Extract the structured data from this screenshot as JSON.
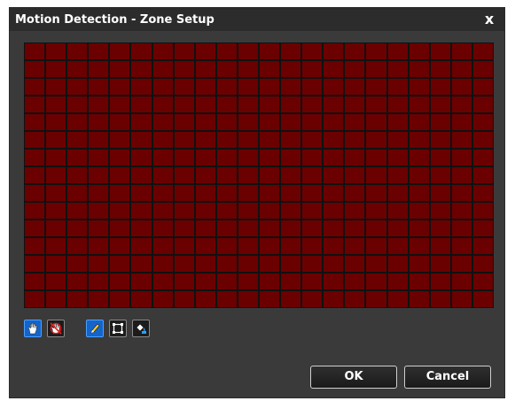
{
  "window": {
    "title": "Motion Detection - Zone Setup",
    "close_glyph": "x"
  },
  "grid": {
    "columns": 22,
    "rows": 15,
    "cell_color": "#6b0000",
    "border_color": "#111111"
  },
  "toolbar": {
    "tools": [
      {
        "icon": "hand-icon",
        "active": true
      },
      {
        "icon": "hand-erase-icon",
        "active": false
      },
      {
        "icon": "pencil-icon",
        "active": true
      },
      {
        "icon": "rectangle-select-icon",
        "active": false
      },
      {
        "icon": "paint-bucket-icon",
        "active": false
      }
    ]
  },
  "buttons": {
    "ok": "OK",
    "cancel": "Cancel"
  },
  "colors": {
    "active_tool": "#1565c8",
    "dialog_bg": "#3a3a3a",
    "title_bg": "#2c2c2c"
  }
}
